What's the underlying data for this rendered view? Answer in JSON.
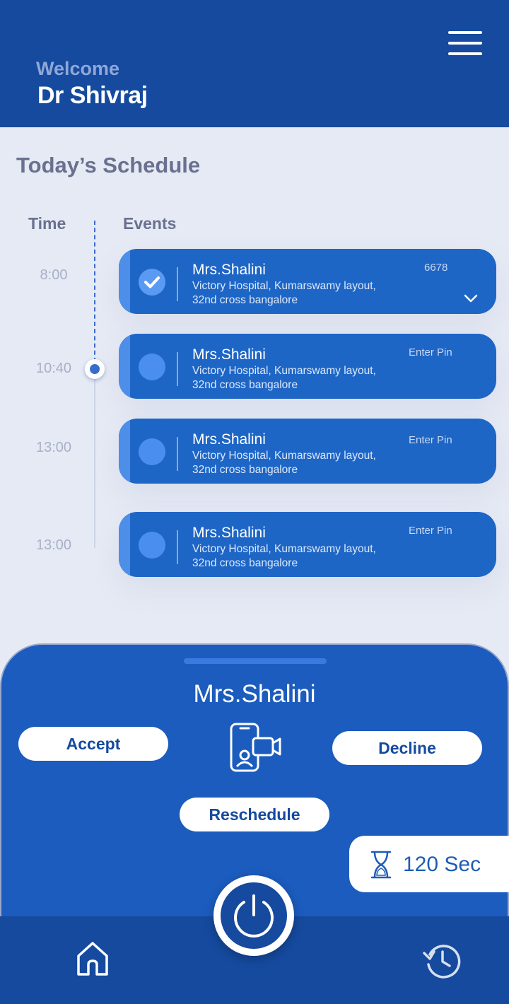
{
  "header": {
    "welcome": "Welcome",
    "doctor_name": "Dr Shivraj",
    "menu_icon": "hamburger-menu-icon"
  },
  "schedule": {
    "title": "Today’s Schedule",
    "col_time": "Time",
    "col_events": "Events",
    "events": [
      {
        "time": "8:00",
        "name": "Mrs.Shalini",
        "address_line1": "Victory Hospital, Kumarswamy layout,",
        "address_line2": "32nd cross bangalore",
        "pin": "6678",
        "completed": true
      },
      {
        "time": "10:40",
        "name": "Mrs.Shalini",
        "address_line1": "Victory Hospital, Kumarswamy layout,",
        "address_line2": "32nd cross bangalore",
        "pin": "Enter Pin",
        "completed": false
      },
      {
        "time": "13:00",
        "name": "Mrs.Shalini",
        "address_line1": "Victory Hospital, Kumarswamy layout,",
        "address_line2": "32nd cross bangalore",
        "pin": "Enter Pin",
        "completed": false
      },
      {
        "time": "13:00",
        "name": "Mrs.Shalini",
        "address_line1": "Victory Hospital, Kumarswamy layout,",
        "address_line2": "32nd cross bangalore",
        "pin": "Enter Pin",
        "completed": false
      }
    ]
  },
  "call_sheet": {
    "patient_name": "Mrs.Shalini",
    "accept_label": "Accept",
    "decline_label": "Decline",
    "reschedule_label": "Reschedule",
    "call_icon": "video-call-icon",
    "timer_icon": "hourglass-icon",
    "timer_text": "120 Sec"
  },
  "bottom_nav": {
    "home_icon": "home-icon",
    "power_icon": "power-icon",
    "history_icon": "history-icon"
  },
  "colors": {
    "primary": "#154a9e",
    "card": "#1e66c6",
    "background": "#e6eaf4"
  }
}
